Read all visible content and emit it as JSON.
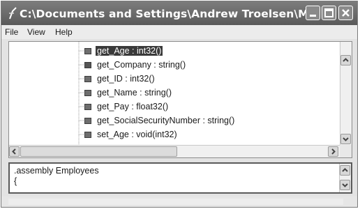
{
  "window": {
    "title": "C:\\Documents and Settings\\Andrew Troelsen\\M..."
  },
  "menu": {
    "items": [
      "File",
      "View",
      "Help"
    ]
  },
  "tree": {
    "items": [
      {
        "label": "get_Age : int32()",
        "selected": true,
        "icon": "method-icon"
      },
      {
        "label": "get_Company : string()",
        "selected": false,
        "icon": "static-method-icon"
      },
      {
        "label": "get_ID : int32()",
        "selected": false,
        "icon": "method-icon"
      },
      {
        "label": "get_Name : string()",
        "selected": false,
        "icon": "method-icon"
      },
      {
        "label": "get_Pay : float32()",
        "selected": false,
        "icon": "method-icon"
      },
      {
        "label": "get_SocialSecurityNumber : string()",
        "selected": false,
        "icon": "method-icon"
      },
      {
        "label": "set_Age : void(int32)",
        "selected": false,
        "icon": "method-icon"
      }
    ]
  },
  "code": {
    "lines": [
      ".assembly Employees",
      "{"
    ]
  }
}
